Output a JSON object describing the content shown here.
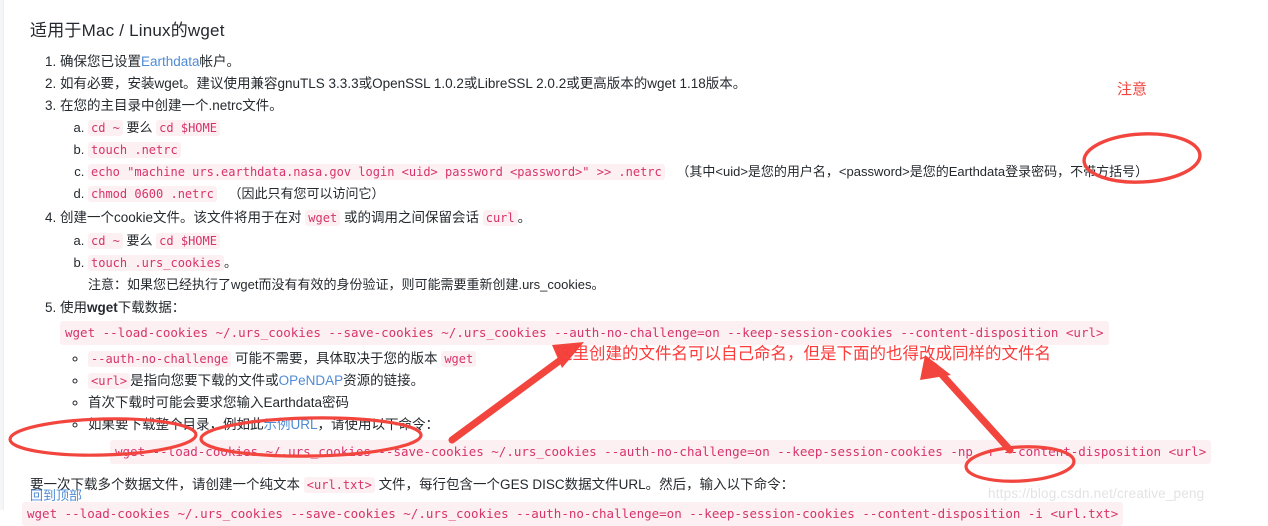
{
  "page": {
    "title": "适用于Mac / Linux的wget",
    "back_to_top": "回到顶部",
    "watermark": "https://blog.csdn.net/creative_peng"
  },
  "steps": [
    {
      "id": "step-1",
      "text_before": "确保您已设置",
      "link": "Earthdata",
      "text_after": "帐户。"
    },
    {
      "id": "step-2",
      "text": "如有必要，安装wget。建议使用兼容gnuTLS 3.3.3或OpenSSL 1.0.2或LibreSSL 2.0.2或更高版本的wget 1.18版本。"
    },
    {
      "id": "step-3",
      "text": "在您的主目录中创建一个.netrc文件。",
      "substeps": [
        {
          "code_a": "cd ~",
          "mid": "要么",
          "code_b": "cd $HOME"
        },
        {
          "code_a": "touch .netrc"
        },
        {
          "code_a": "echo \"machine urs.earthdata.nasa.gov login <uid> password <password>\" >> .netrc",
          "trailing": "（其中<uid>是您的用户名，<password>是您的Earthdata登录密码，不带方括号）"
        },
        {
          "code_a": "chmod 0600 .netrc",
          "trailing": "（因此只有您可以访问它）"
        }
      ]
    },
    {
      "id": "step-4",
      "text_parts": {
        "p1": "创建一个cookie文件。该文件将用于在对",
        "code1": "wget",
        "p2": "或的调用之间保留会话",
        "code2": "curl",
        "p3": "。"
      },
      "substeps": [
        {
          "code_a": "cd ~",
          "mid": "要么",
          "code_b": "cd $HOME"
        },
        {
          "code_a": "touch .urs_cookies",
          "trailing": "。"
        }
      ],
      "note": "注意：如果您已经执行了wget而没有有效的身份验证，则可能需要重新创建.urs_cookies。"
    },
    {
      "id": "step-5",
      "text_pre": "使用",
      "text_bold": "wget",
      "text_post": "下载数据：",
      "command": "wget --load-cookies ~/.urs_cookies --save-cookies ~/.urs_cookies --auth-no-challenge=on --keep-session-cookies --content-disposition <url>",
      "bullets": [
        {
          "code": "--auth-no-challenge",
          "text": "可能不需要，具体取决于您的版本",
          "code_end": "wget"
        },
        {
          "code": "<url>",
          "text_before": "是指向您要下载的文件或",
          "link": "OPeNDAP",
          "text_after": "资源的链接。"
        },
        {
          "text_plain": "首次下载时可能会要求您输入Earthdata密码"
        },
        {
          "text_before": "如果要下载整个目录，例如此",
          "link": "示例URL",
          "text_after": "，请使用以下命令："
        }
      ],
      "command_dir": "wget --load-cookies ~/.urs_cookies --save-cookies ~/.urs_cookies --auth-no-challenge=on --keep-session-cookies -np -r --content-disposition <url>"
    }
  ],
  "multi_download": {
    "seg1": "要一次下载多个数据文件，",
    "seg2": "请创建一个纯文本",
    "code": "<url.txt>",
    "seg3": "文件，",
    "seg4": "每行包含一个GES DISC数据文件URL。然后，输入以下命令：",
    "command_pre": "wget --load-cookies ~/.urs_cookies --save-cookies ~/.urs_cookies --auth-no-challenge=on --keep-session-cookies --content-disposition -i ",
    "command_target": "<url.txt>"
  },
  "annotations": {
    "note_label": "注意",
    "main_note": "这里创建的文件名可以自己命名，但是下面的也得改成同样的文件名",
    "color": "#fc3b3b"
  }
}
